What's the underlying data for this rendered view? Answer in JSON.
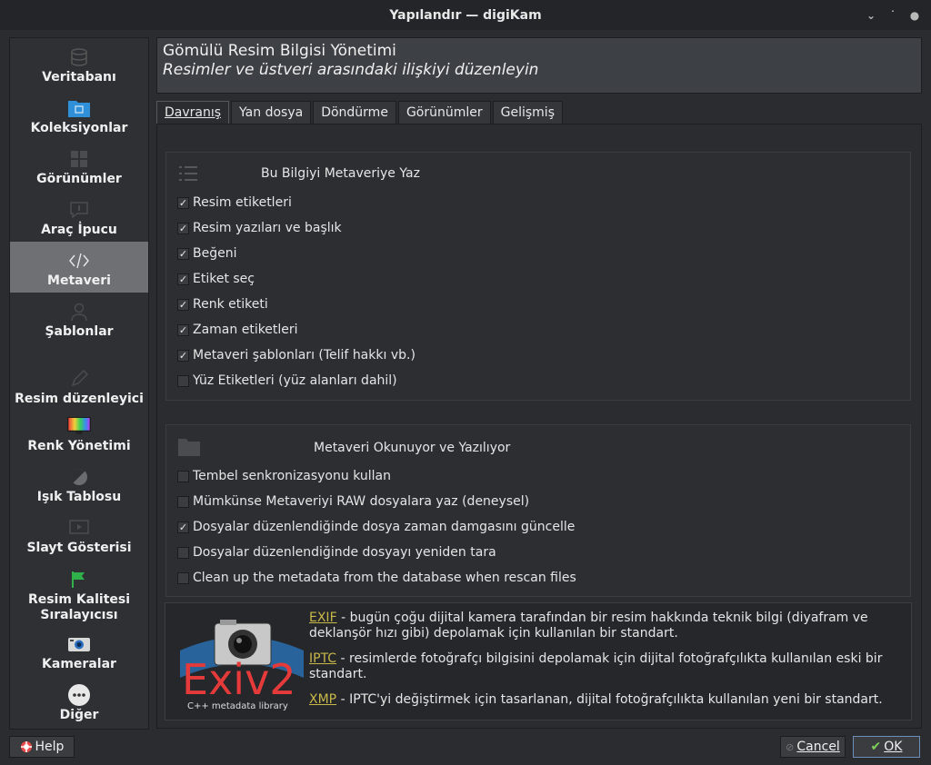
{
  "window": {
    "title": "Yapılandır — digiKam"
  },
  "sidebar": {
    "items": [
      {
        "label": "Veritabanı",
        "icon": "database-icon"
      },
      {
        "label": "Koleksiyonlar",
        "icon": "folder-icon"
      },
      {
        "label": "Görünümler",
        "icon": "grid-icon"
      },
      {
        "label": "Araç İpucu",
        "icon": "tooltip-icon"
      },
      {
        "label": "Metaveri",
        "icon": "code-icon"
      },
      {
        "label": "Şablonlar",
        "icon": "person-icon"
      },
      {
        "label": "Resim düzenleyici",
        "icon": "pencil-icon"
      },
      {
        "label": "Renk Yönetimi",
        "icon": "monitor-icon"
      },
      {
        "label": "Işık Tablosu",
        "icon": "contrast-icon"
      },
      {
        "label": "Slayt Gösterisi",
        "icon": "slideshow-icon"
      },
      {
        "label": "Resim Kalitesi Sıralayıcısı",
        "icon": "flag-icon"
      },
      {
        "label": "Kameralar",
        "icon": "camera-icon"
      },
      {
        "label": "Diğer",
        "icon": "more-icon"
      }
    ]
  },
  "header": {
    "title": "Gömülü Resim Bilgisi Yönetimi",
    "subtitle": "Resimler ve üstveri arasındaki ilişkiyi düzenleyin"
  },
  "tabs": [
    "Davranış",
    "Yan dosya",
    "Döndürme",
    "Görünümler",
    "Gelişmiş"
  ],
  "group1": {
    "title": "Bu Bilgiyi Metaveriye Yaz",
    "items": [
      {
        "label": "Resim etiketleri",
        "checked": true
      },
      {
        "label": "Resim yazıları ve başlık",
        "checked": true
      },
      {
        "label": "Beğeni",
        "checked": true
      },
      {
        "label": "Etiket seç",
        "checked": true
      },
      {
        "label": "Renk etiketi",
        "checked": true
      },
      {
        "label": "Zaman etiketleri",
        "checked": true
      },
      {
        "label": "Metaveri şablonları (Telif hakkı vb.)",
        "checked": true
      },
      {
        "label": "Yüz Etiketleri (yüz alanları dahil)",
        "checked": false
      }
    ]
  },
  "group2": {
    "title": "Metaveri Okunuyor ve Yazılıyor",
    "items": [
      {
        "label": "Tembel senkronizasyonu kullan",
        "checked": false
      },
      {
        "label": "Mümkünse Metaveriyi RAW dosyalara yaz (deneysel)",
        "checked": false
      },
      {
        "label": "Dosyalar düzenlendiğinde dosya zaman damgasını güncelle",
        "checked": true
      },
      {
        "label": "Dosyalar düzenlendiğinde dosyayı yeniden tara",
        "checked": false
      },
      {
        "label": "Clean up the metadata from the database when rescan files",
        "checked": false
      }
    ]
  },
  "info": {
    "logo_text": "Exiv2",
    "logo_sub": "C++ metadata library",
    "exif_link": "EXIF",
    "exif_text": " - bugün çoğu dijital kamera tarafından bir resim hakkında teknik bilgi (diyafram ve deklanşör hızı gibi) depolamak için kullanılan bir standart.",
    "iptc_link": "IPTC",
    "iptc_text": " - resimlerde fotoğrafçı bilgisini depolamak için dijital fotoğrafçılıkta kullanılan eski bir standart.",
    "xmp_link": "XMP",
    "xmp_text": " - IPTC'yi değiştirmek için tasarlanan, dijital fotoğrafçılıkta kullanılan yeni bir standart."
  },
  "buttons": {
    "help": "Help",
    "cancel": "Cancel",
    "ok": "OK"
  },
  "colors": {
    "accent_link": "#c8b84a",
    "active_sidebar": "#6f7073"
  }
}
